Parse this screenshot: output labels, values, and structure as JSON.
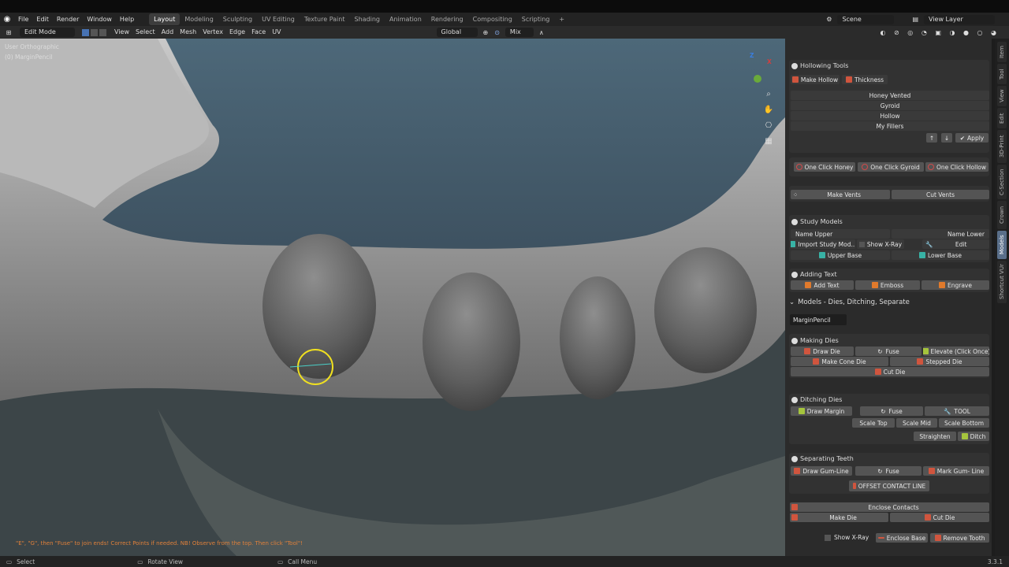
{
  "topmenu": {
    "file": "File",
    "edit": "Edit",
    "render": "Render",
    "window": "Window",
    "help": "Help"
  },
  "workspaces": [
    "Layout",
    "Modeling",
    "Sculpting",
    "UV Editing",
    "Texture Paint",
    "Shading",
    "Animation",
    "Rendering",
    "Compositing",
    "Scripting"
  ],
  "scene": "Scene",
  "view_layer": "View Layer",
  "header": {
    "mode": "Edit Mode",
    "view": "View",
    "select": "Select",
    "add": "Add",
    "mesh": "Mesh",
    "vertex": "Vertex",
    "edge": "Edge",
    "face": "Face",
    "uv": "UV",
    "orientation": "Global",
    "snap": "Mix"
  },
  "viewport": {
    "view_name": "User Orthographic",
    "object": "(0) MarginPencil",
    "hint": "\"E\", \"G\", then \"Fuse\" to join ends! Correct Points if needed. NB! Observe from the top. Then click \"Tool\"!",
    "axis_x": "X",
    "axis_z": "Z"
  },
  "status": {
    "select": "Select",
    "rotate": "Rotate View",
    "call_menu": "Call Menu",
    "version": "3.3.1"
  },
  "sidetabs": [
    "Item",
    "Tool",
    "View",
    "Edit",
    "3D-Print",
    "C-Section",
    "Crown",
    "Models",
    "Shortcut VUr"
  ],
  "hollowing": {
    "title": "Hollowing Tools",
    "make_hollow": "Make Hollow",
    "thickness": "Thickness",
    "list": [
      "Honey Vented",
      "Gyroid",
      "Hollow",
      "My Fillers"
    ],
    "apply": "Apply",
    "one_honey": "One Click Honey",
    "one_gyroid": "One Click Gyroid",
    "one_hollow": "One Click Hollow",
    "make_vents": "Make Vents",
    "cut_vents": "Cut Vents"
  },
  "study": {
    "title": "Study Models",
    "name_upper": "Name Upper",
    "name_lower": "Name Lower",
    "import": "Import Study Mod...",
    "xray": "Show X-Ray",
    "edit": "Edit",
    "upper_base": "Upper Base",
    "lower_base": "Lower Base"
  },
  "text": {
    "title": "Adding Text",
    "add": "Add Text",
    "emboss": "Emboss",
    "engrave": "Engrave"
  },
  "models": {
    "title": "Models - Dies, Ditching, Separate",
    "object": "MarginPencil"
  },
  "dies": {
    "title": "Making Dies",
    "draw": "Draw Die",
    "fuse": "Fuse",
    "elevate": "Elevate (Click Once)",
    "cone": "Make Cone Die",
    "stepped": "Stepped Die",
    "cut": "Cut Die"
  },
  "ditch": {
    "title": "Ditching Dies",
    "draw_margin": "Draw Margin",
    "fuse": "Fuse",
    "tool": "TOOL",
    "scale_top": "Scale Top",
    "scale_mid": "Scale Mid",
    "scale_bottom": "Scale Bottom",
    "straighten": "Straighten",
    "ditch": "Ditch"
  },
  "sep": {
    "title": "Separating Teeth",
    "draw_gum": "Draw Gum-Line",
    "fuse": "Fuse",
    "mark_gum": "Mark Gum- Line",
    "offset": "OFFSET CONTACT LINE",
    "enclose": "Enclose Contacts",
    "make_die": "Make Die",
    "cut_die": "Cut Die",
    "xray": "Show X-Ray",
    "enclose_base": "Enclose Base",
    "remove_tooth": "Remove Tooth"
  }
}
